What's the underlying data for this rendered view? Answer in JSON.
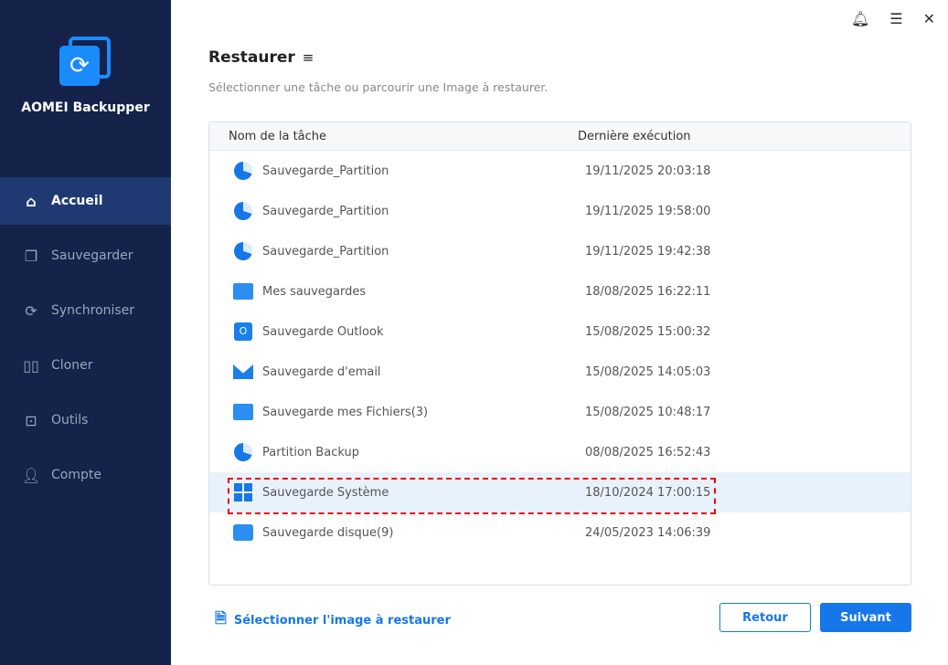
{
  "app": {
    "name": "AOMEI Backupper"
  },
  "sidebar": {
    "items": [
      {
        "label": "Accueil",
        "icon": "home-icon"
      },
      {
        "label": "Sauvegarder",
        "icon": "copy-icon"
      },
      {
        "label": "Synchroniser",
        "icon": "sync-icon"
      },
      {
        "label": "Cloner",
        "icon": "clone-icon"
      },
      {
        "label": "Outils",
        "icon": "toolbox-icon"
      },
      {
        "label": "Compte",
        "icon": "user-icon"
      }
    ]
  },
  "page": {
    "title": "Restaurer",
    "subtitle": "Sélectionner une tâche ou parcourir une Image à restaurer."
  },
  "table": {
    "headers": [
      "Nom de la tâche",
      "Dernière exécution"
    ],
    "rows": [
      {
        "name": "Sauvegarde_Partition",
        "date": "19/11/2025 20:03:18",
        "icon": "partition"
      },
      {
        "name": "Sauvegarde_Partition",
        "date": "19/11/2025 19:58:00",
        "icon": "partition"
      },
      {
        "name": "Sauvegarde_Partition",
        "date": "19/11/2025 19:42:38",
        "icon": "partition"
      },
      {
        "name": "Mes sauvegardes",
        "date": "18/08/2025 16:22:11",
        "icon": "folder"
      },
      {
        "name": "Sauvegarde Outlook",
        "date": "15/08/2025 15:00:32",
        "icon": "outlook"
      },
      {
        "name": "Sauvegarde d'email",
        "date": "15/08/2025 14:05:03",
        "icon": "mail"
      },
      {
        "name": "Sauvegarde mes Fichiers(3)",
        "date": "15/08/2025 10:48:17",
        "icon": "folder"
      },
      {
        "name": "Partition Backup",
        "date": "08/08/2025 16:52:43",
        "icon": "partition"
      },
      {
        "name": "Sauvegarde Système",
        "date": "18/10/2024 17:00:15",
        "icon": "windows",
        "selected": true
      },
      {
        "name": "Sauvegarde disque(9)",
        "date": "24/05/2023 14:06:39",
        "icon": "disk"
      }
    ]
  },
  "footer": {
    "select_image": "Sélectionner l'image à restaurer",
    "back": "Retour",
    "next": "Suivant"
  }
}
